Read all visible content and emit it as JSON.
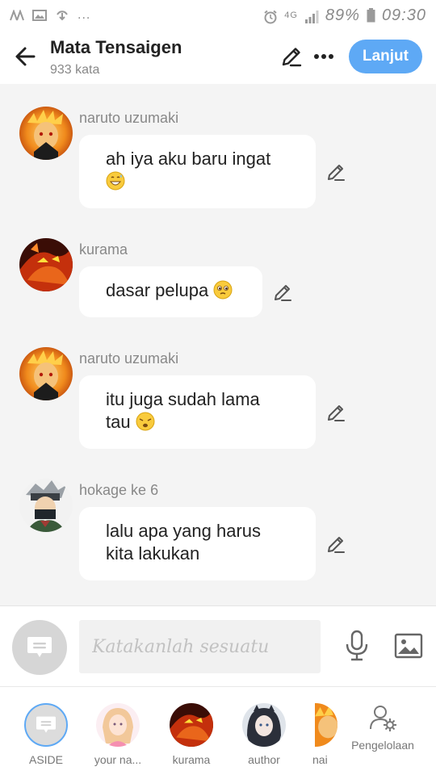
{
  "status_bar": {
    "network": "4G",
    "battery": "89%",
    "time": "09:30",
    "overflow": "..."
  },
  "header": {
    "title": "Mata Tensaigen",
    "subtitle": "933 kata",
    "next_label": "Lanjut"
  },
  "messages": [
    {
      "sender": "naruto uzumaki",
      "text_lines": [
        "ah iya aku baru ingat"
      ],
      "emoji": "grin-sweat-emoji"
    },
    {
      "sender": "kurama",
      "text_lines": [
        "dasar pelupa"
      ],
      "emoji": "pleading-emoji"
    },
    {
      "sender": "naruto uzumaki",
      "text_lines": [
        "itu juga sudah lama",
        "tau"
      ],
      "emoji": "tired-emoji"
    },
    {
      "sender": "hokage ke 6",
      "text_lines": [
        "lalu apa yang harus",
        "kita lakukan"
      ],
      "emoji": ""
    }
  ],
  "composer": {
    "placeholder": "Katakanlah sesuatu"
  },
  "characters": [
    {
      "label": "ASIDE",
      "icon": "chat-bubble-icon"
    },
    {
      "label": "your na..."
    },
    {
      "label": "kurama"
    },
    {
      "label": "author"
    },
    {
      "label": "nai"
    }
  ],
  "manage": {
    "label": "Pengelolaan",
    "icon": "user-gear-icon"
  },
  "colors": {
    "accent": "#5ea9f5",
    "bubble": "#ffffff",
    "background": "#f4f4f4",
    "muted_text": "#888888"
  }
}
